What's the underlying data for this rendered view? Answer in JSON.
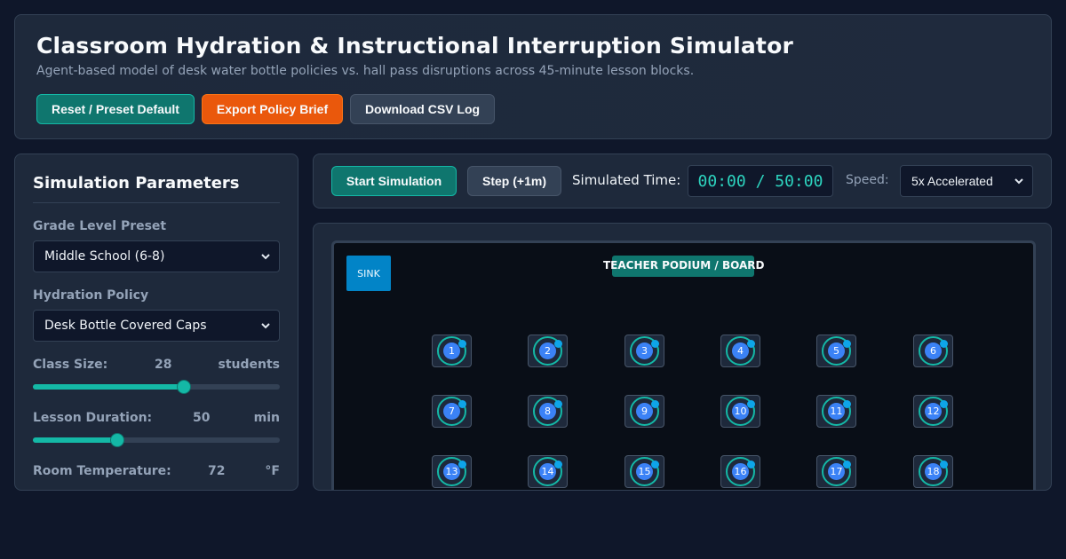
{
  "header": {
    "title": "Classroom Hydration & Instructional Interruption Simulator",
    "subtitle": "Agent-based model of desk water bottle policies vs. hall pass disruptions across 45-minute lesson blocks.",
    "buttons": {
      "reset": "Reset / Preset Default",
      "export": "Export Policy Brief",
      "download": "Download CSV Log"
    }
  },
  "sidebar": {
    "title": "Simulation Parameters",
    "grade_label": "Grade Level Preset",
    "grade_value": "Middle School (6-8)",
    "policy_label": "Hydration Policy",
    "policy_value": "Desk Bottle Covered Caps",
    "class_size": {
      "label": "Class Size:",
      "value": "28",
      "unit": "students",
      "fraction": 0.61
    },
    "lesson_duration": {
      "label": "Lesson Duration:",
      "value": "50",
      "unit": "min",
      "fraction": 0.34
    },
    "room_temperature": {
      "label": "Room Temperature:",
      "value": "72",
      "unit": "°F"
    }
  },
  "controls": {
    "start": "Start Simulation",
    "step": "Step (+1m)",
    "time_label": "Simulated Time:",
    "time_value": "00:00 / 50:00",
    "speed_label": "Speed:",
    "speed_value": "5x Accelerated"
  },
  "classroom": {
    "sink_label": "SINK",
    "podium_label": "TEACHER PODIUM / BOARD",
    "students": [
      "1",
      "2",
      "3",
      "4",
      "5",
      "6",
      "7",
      "8",
      "9",
      "10",
      "11",
      "12",
      "13",
      "14",
      "15",
      "16",
      "17",
      "18"
    ]
  },
  "colors": {
    "accent": "#14b8a6",
    "export": "#ea580c",
    "student": "#3b82f6",
    "sink": "#0284c7"
  }
}
